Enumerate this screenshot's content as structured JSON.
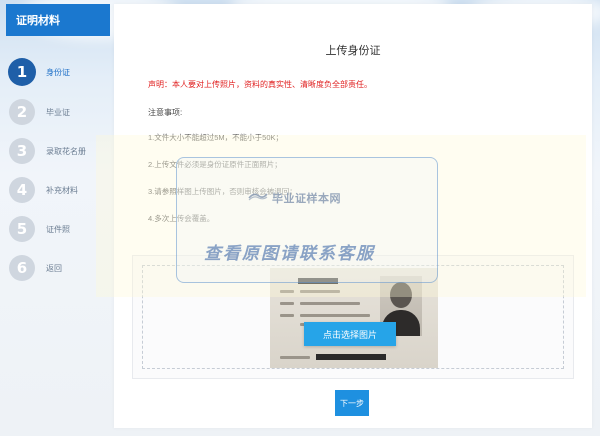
{
  "sidebar": {
    "header": "证明材料",
    "steps": [
      {
        "num": "1",
        "label": "身份证"
      },
      {
        "num": "2",
        "label": "毕业证"
      },
      {
        "num": "3",
        "label": "录取花名册"
      },
      {
        "num": "4",
        "label": "补充材料"
      },
      {
        "num": "5",
        "label": "证件照"
      },
      {
        "num": "6",
        "label": "返回"
      }
    ]
  },
  "main": {
    "title": "上传身份证",
    "declaration": "声明：本人要对上传照片，资料的真实性、清晰度负全部责任。",
    "notes_title": "注意事项:",
    "notes": [
      "1.文件大小不能超过5M，不能小于50K；",
      "2.上传文件必须是身份证原件正面照片；",
      "3.请参照样图上传图片，否则审核会被退回；",
      "4.多次上传会覆盖。"
    ],
    "select_button": "点击选择图片",
    "next_button": "下一步"
  },
  "watermark": {
    "logo": "毕业证样本网",
    "text": "查看原图请联系客服"
  },
  "colors": {
    "accent": "#1b78cf",
    "active_step": "#1f5fa8",
    "warning": "#e02020",
    "button": "#26a4e8"
  }
}
